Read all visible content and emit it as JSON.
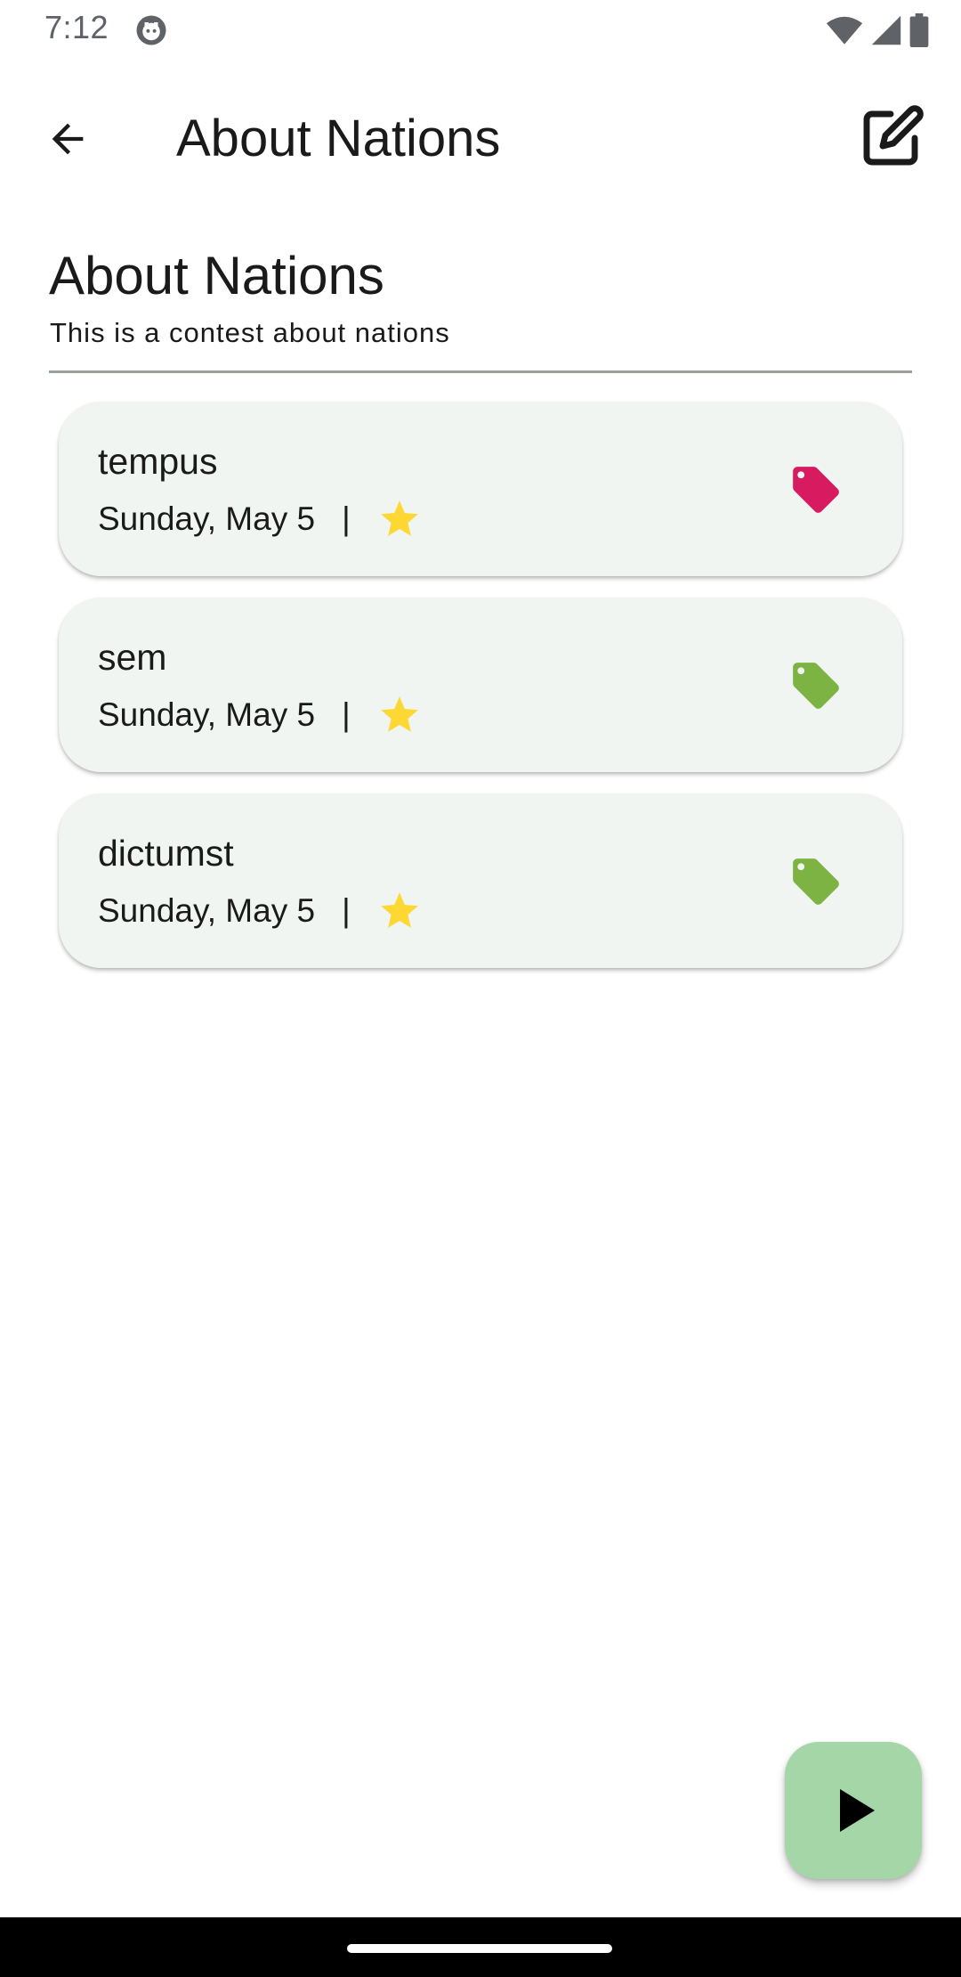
{
  "status_bar": {
    "time": "7:12",
    "app_icon": "android-debug-icon",
    "icons": [
      "wifi-icon",
      "cellular-signal-icon",
      "battery-icon"
    ]
  },
  "app_bar": {
    "back_icon": "arrow-back-icon",
    "title": "About Nations",
    "edit_icon": "edit-icon"
  },
  "contest": {
    "title": "About Nations",
    "description": "This is a contest about nations"
  },
  "items": [
    {
      "name": "tempus",
      "date": "Sunday, May 5",
      "separator": "|",
      "star_icon": "star-icon",
      "tag_icon": "tag-icon",
      "tag_color": "#d81b60",
      "star_color": "#fdd835"
    },
    {
      "name": "sem",
      "date": "Sunday, May 5",
      "separator": "|",
      "star_icon": "star-icon",
      "tag_icon": "tag-icon",
      "tag_color": "#7cb342",
      "star_color": "#fdd835"
    },
    {
      "name": "dictumst",
      "date": "Sunday, May 5",
      "separator": "|",
      "star_icon": "star-icon",
      "tag_icon": "tag-icon",
      "tag_color": "#7cb342",
      "star_color": "#fdd835"
    }
  ],
  "fab": {
    "icon": "play-icon",
    "color": "#a5d6a7"
  },
  "colors": {
    "card_background": "#f1f5f1",
    "divider": "#9aa09a"
  }
}
